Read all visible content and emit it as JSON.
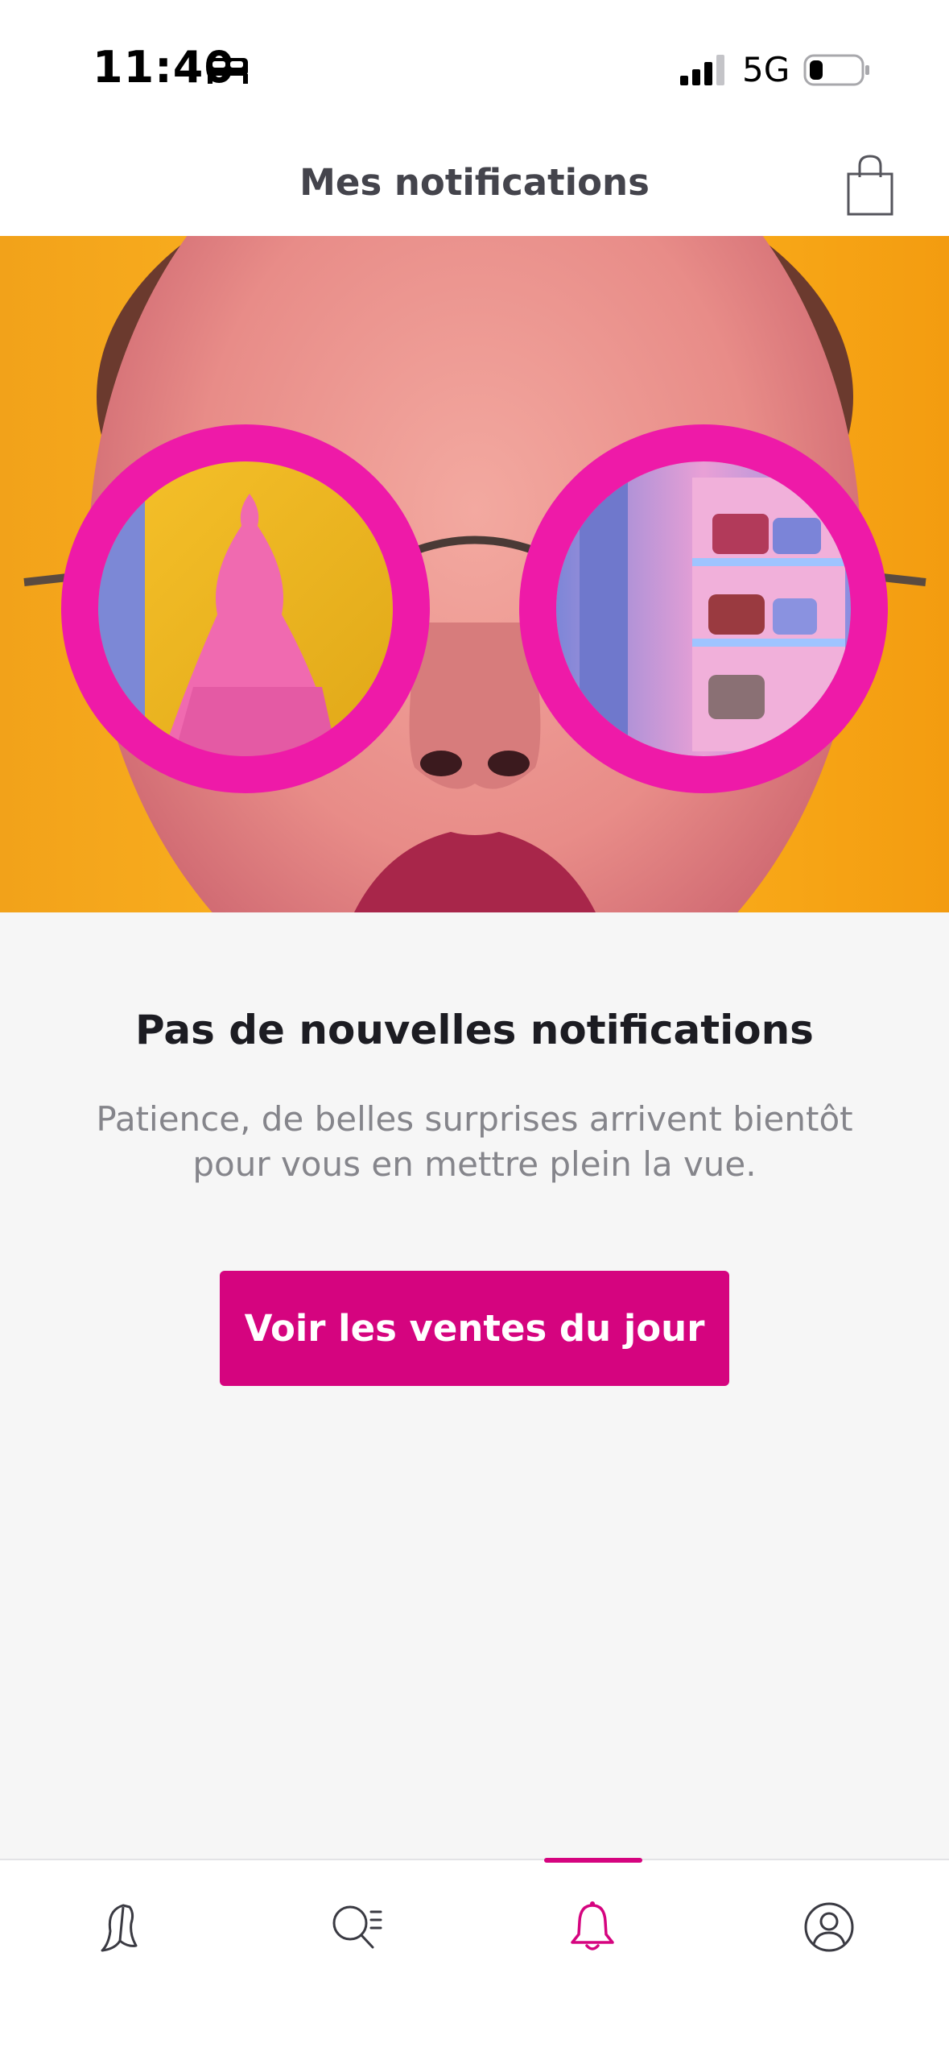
{
  "status_bar": {
    "time": "11:40",
    "network": "5G",
    "icons": [
      "sleep-bed-icon",
      "signal-icon",
      "battery-icon"
    ]
  },
  "header": {
    "title": "Mes notifications",
    "cart_icon": "shopping-bag-icon"
  },
  "hero": {
    "image": "woman-pink-sunglasses-reflection-image"
  },
  "empty_state": {
    "title": "Pas de nouvelles notifications",
    "message": "Patience, de belles surprises arrivent bientôt pour vous en mettre plein la vue.",
    "cta_label": "Voir les ventes du jour"
  },
  "tab_bar": {
    "items": [
      {
        "icon": "butterfly-home-icon",
        "active": false
      },
      {
        "icon": "search-list-icon",
        "active": false
      },
      {
        "icon": "bell-icon",
        "active": true
      },
      {
        "icon": "profile-icon",
        "active": false
      }
    ]
  },
  "colors": {
    "accent": "#d5047f",
    "background": "#f6f6f6",
    "header_text": "#44444c",
    "muted_text": "#85858b"
  }
}
